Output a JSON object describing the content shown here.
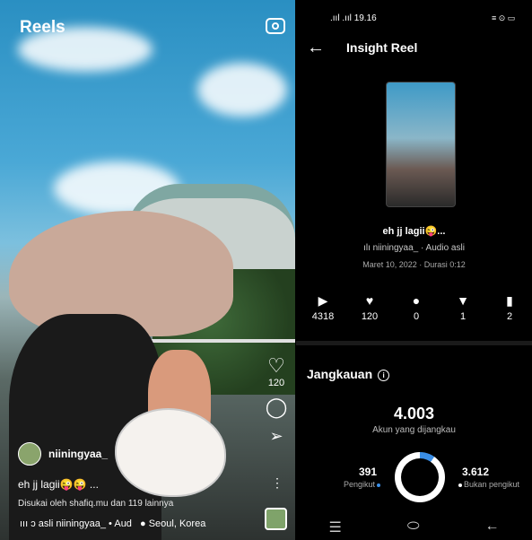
{
  "reels_screen": {
    "title": "Reels",
    "camera_icon": "camera-icon",
    "like_count": "120",
    "author": "niiningyaa_",
    "caption": "eh jj lagii😜😜 ...",
    "liked_by": "Disukai oleh shafiq.mu dan 119 lainnya",
    "audio_text": "ııı ɔ asli  niiningyaa_ • Aud",
    "location": "Seoul, Korea"
  },
  "insight": {
    "status_time": "19.16",
    "status_signal": ".ııl .ııl",
    "status_icons": "≡ ⊙ ▭",
    "title": "Insight Reel",
    "reel_caption": "eh jj lagii😜...",
    "reel_audio": "niiningyaa_ · Audio asli",
    "reel_date": "Maret 10, 2022 · Durasi 0:12",
    "stats": {
      "plays": "4318",
      "likes": "120",
      "comments": "0",
      "shares": "1",
      "saves": "2"
    },
    "reach_title": "Jangkauan",
    "accounts_reached": "4.003",
    "accounts_reached_label": "Akun yang dijangkau",
    "followers": "391",
    "followers_label": "Pengikut",
    "non_followers": "3.612",
    "non_followers_label": "Bukan pengikut",
    "followers_fraction": 0.098,
    "accent_color": "#3a8ee6"
  }
}
